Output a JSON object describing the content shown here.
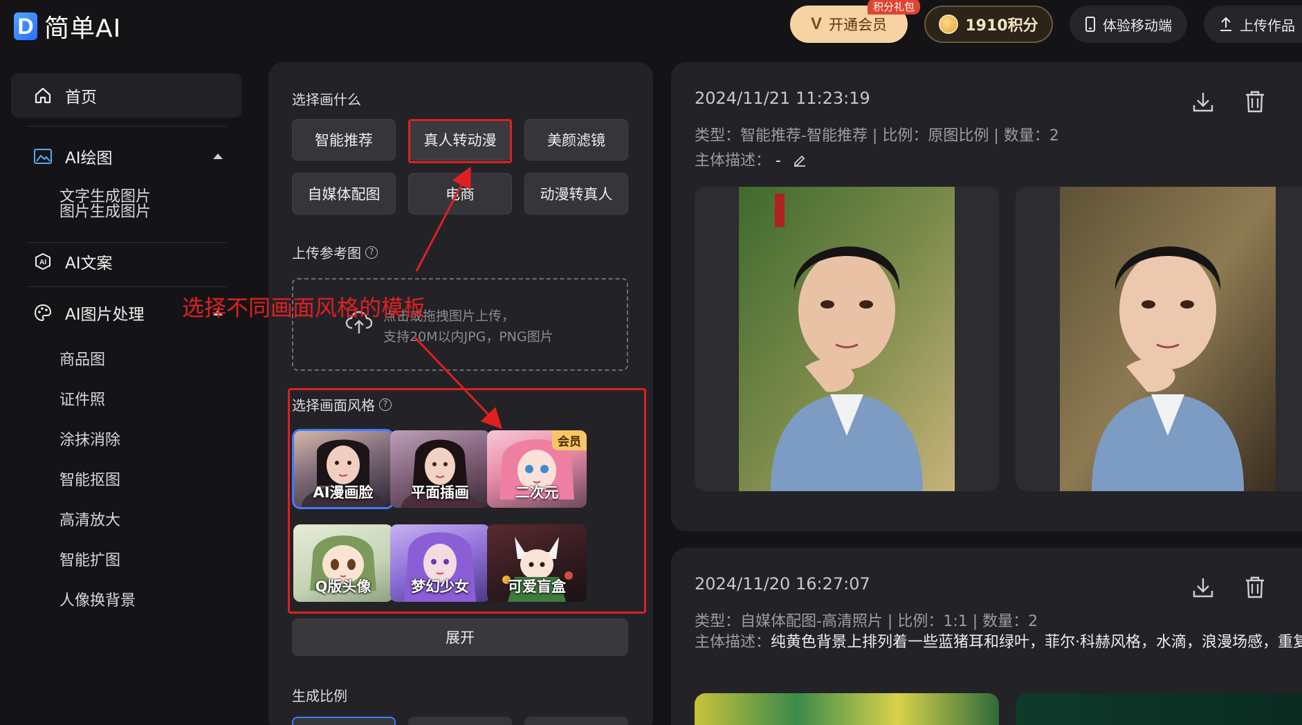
{
  "header": {
    "logo_letter": "D",
    "app_name": "简单AI",
    "vip_label": "开通会员",
    "vip_badge": "积分礼包",
    "points_label": "1910积分",
    "mobile_label": "体验移动端",
    "upload_label": "上传作品"
  },
  "sidebar": {
    "home": "首页",
    "ai_draw": "AI绘图",
    "ai_draw_items": [
      "文字生成图片",
      "图片生成图片"
    ],
    "ai_copy": "AI文案",
    "ai_image": "AI图片处理",
    "ai_image_items": [
      "商品图",
      "证件照",
      "涂抹消除",
      "智能抠图",
      "高清放大",
      "智能扩图",
      "人像换背景"
    ]
  },
  "panel": {
    "choose_what_label": "选择画什么",
    "categories": [
      "智能推荐",
      "真人转动漫",
      "美颜滤镜",
      "自媒体配图",
      "电商",
      "动漫转真人"
    ],
    "selected_category": "真人转动漫",
    "upload_label": "上传参考图",
    "upload_hint_1": "点击或拖拽图片上传，",
    "upload_hint_2": "支持20M以内JPG，PNG图片",
    "style_label": "选择画面风格",
    "styles": [
      {
        "name": "AI漫画脸",
        "member": ""
      },
      {
        "name": "平面插画",
        "member": ""
      },
      {
        "name": "二次元",
        "member": "会员"
      },
      {
        "name": "Q版头像",
        "member": ""
      },
      {
        "name": "梦幻少女",
        "member": ""
      },
      {
        "name": "可爱盲盒",
        "member": ""
      }
    ],
    "expand_label": "展开",
    "ratio_label": "生成比例"
  },
  "annotation": {
    "text": "选择不同画面风格的模板",
    "color": "#e02020"
  },
  "results": [
    {
      "time": "2024/11/21 11:23:19",
      "meta": "类型：智能推荐-智能推荐 | 比例：原图比例 | 数量：2",
      "desc_label": "主体描述：",
      "desc_value": "-"
    },
    {
      "time": "2024/11/20 16:27:07",
      "meta": "类型：自媒体配图-高清照片 | 比例：1:1 | 数量：2",
      "desc_label": "主体描述：",
      "desc_value": "纯黄色背景上排列着一些蓝猪耳和绿叶，菲尔·科赫风格，水滴，浪漫场感，重复"
    }
  ],
  "colors": {
    "accent_blue": "#3e7bff",
    "annotation_red": "#e02020",
    "vip_gold": "#f7d3a3"
  }
}
